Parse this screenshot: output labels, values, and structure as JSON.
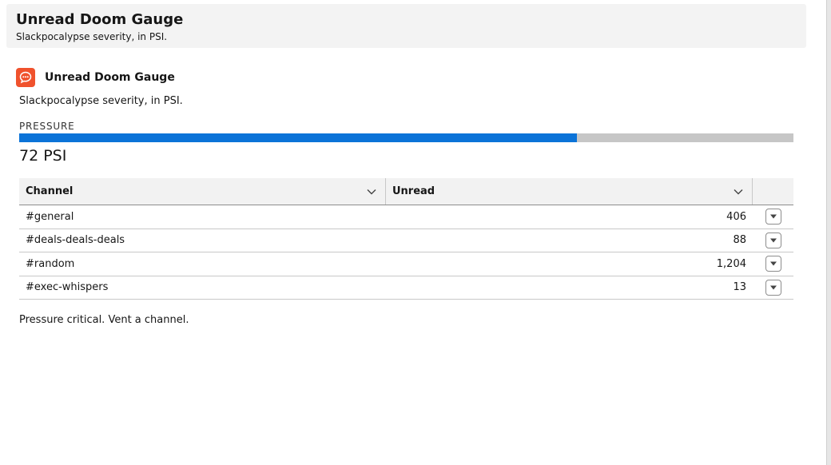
{
  "header": {
    "title": "Unread Doom Gauge",
    "subtitle": "Slackpocalypse severity, in PSI."
  },
  "card": {
    "icon": "chat-bubble-icon",
    "title": "Unread Doom Gauge",
    "description": "Slackpocalypse severity, in PSI."
  },
  "gauge": {
    "label": "PRESSURE",
    "value": 72,
    "max": 100,
    "value_text": "72 PSI",
    "fill_color": "#0b73d8",
    "track_color": "#c6c6c6"
  },
  "table": {
    "columns": [
      {
        "label": "Channel"
      },
      {
        "label": "Unread"
      }
    ],
    "rows": [
      {
        "channel": "#general",
        "unread": "406"
      },
      {
        "channel": "#deals-deals-deals",
        "unread": "88"
      },
      {
        "channel": "#random",
        "unread": "1,204"
      },
      {
        "channel": "#exec-whispers",
        "unread": "13"
      }
    ]
  },
  "footer": {
    "message": "Pressure critical. Vent a channel."
  },
  "colors": {
    "accent": "#0b73d8",
    "app_icon": "#f0522d"
  }
}
